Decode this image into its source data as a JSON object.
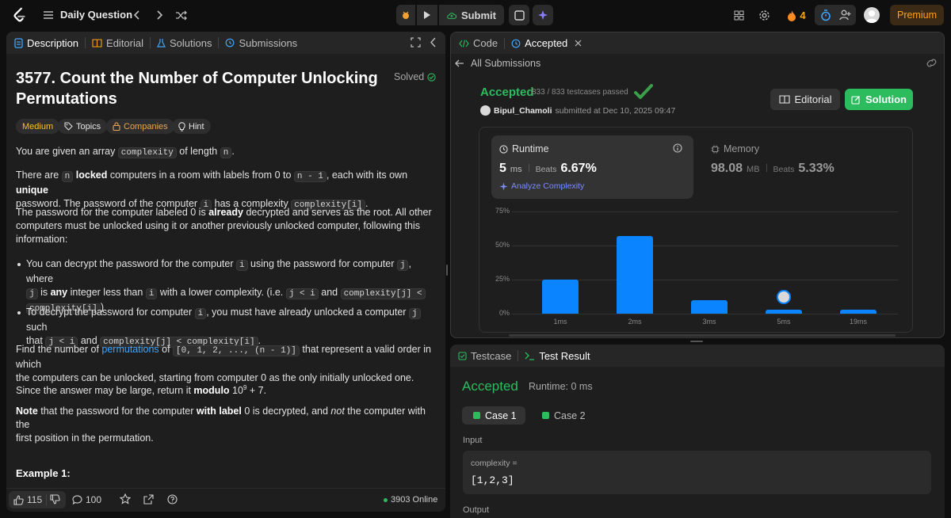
{
  "topbar": {
    "title": "Daily Question",
    "submit_label": "Submit",
    "streak_count": "4",
    "premium_label": "Premium"
  },
  "left_panel": {
    "tabs": [
      "Description",
      "Editorial",
      "Solutions",
      "Submissions"
    ],
    "problem_title_line1": "3577. Count the Number of Computer Unlocking",
    "problem_title_line2": "Permutations",
    "solved_label": "Solved",
    "tags": [
      "Medium",
      "Topics",
      "Companies",
      "Hint"
    ],
    "p1": {
      "a": "You are given an array ",
      "code1": "complexity",
      "b": " of length ",
      "code2": "n",
      "c": "."
    },
    "p2": {
      "a": "There are ",
      "code1": "n",
      "b1": " ",
      "bold1": "locked",
      "b2": " computers in a room with labels from 0 to ",
      "code2": "n - 1",
      "c1": ", each with its own ",
      "bold2": "unique",
      "d": "password. The password of the computer ",
      "code3": "i",
      "e": " has a complexity ",
      "code4": "complexity[i]",
      "f": "."
    },
    "p3": {
      "a": "The password for the computer labeled 0 is ",
      "bold": "already",
      "b": " decrypted and serves as the root. All other",
      "line2": "computers must be unlocked using it or another previously unlocked computer, following this",
      "line3": "information:"
    },
    "bullet1": {
      "a": "You can decrypt the password for the computer ",
      "code1": "i",
      "b": " using the password for computer ",
      "code2": "j",
      "c": ", where",
      "code3": "j",
      "d1": " is ",
      "bold": "any",
      "d2": " integer less than ",
      "code4": "i",
      "e": " with a lower complexity. (i.e. ",
      "code5": "j < i",
      "f": " and ",
      "code6": "complexity[j] <",
      "code7": "complexity[i]",
      "g": ")"
    },
    "bullet2": {
      "a": "To decrypt the password for computer ",
      "code1": "i",
      "b": ", you must have already unlocked a computer ",
      "code2": "j",
      "c": " such",
      "d": "that ",
      "code3": "j < i",
      "e": " and ",
      "code4": "complexity[j] < complexity[i]",
      "f": "."
    },
    "p4": {
      "a": "Find the number of ",
      "link": "permutations",
      "b": " of ",
      "code": "[0, 1, 2, ..., (n - 1)]",
      "c": " that represent a valid order in which",
      "line2": "the computers can be unlocked, starting from computer 0 as the only initially unlocked one."
    },
    "p5": {
      "a": "Since the answer may be large, return it ",
      "bold": "modulo",
      "b": " 10",
      "sup": "9",
      "c": " + 7."
    },
    "p6": {
      "bold1": "Note",
      "a": " that the password for the computer ",
      "bold2": "with label",
      "b": " 0 is decrypted, and ",
      "em": "not",
      "c": " the computer with the",
      "line2": "first position in the permutation."
    },
    "example_heading": "Example 1:",
    "footer": {
      "likes": "115",
      "comments": "100",
      "online": "3903 Online"
    }
  },
  "right_top": {
    "tabs": [
      "Code",
      "Accepted"
    ],
    "back_label": "All Submissions",
    "status": "Accepted",
    "testcases": "833 / 833 testcases passed",
    "user": "Bipul_Chamoli",
    "submitted": "submitted at Dec 10, 2025 09:47",
    "editorial_btn": "Editorial",
    "solution_btn": "Solution",
    "runtime": {
      "label": "Runtime",
      "value": "5",
      "unit": "ms",
      "beats_label": "Beats",
      "beats": "6.67%",
      "analyze": "Analyze Complexity"
    },
    "memory": {
      "label": "Memory",
      "value": "98.08",
      "unit": "MB",
      "beats_label": "Beats",
      "beats": "5.33%"
    }
  },
  "chart_data": {
    "type": "bar",
    "categories": [
      "1ms",
      "2ms",
      "3ms",
      "5ms",
      "19ms"
    ],
    "values": [
      25,
      57,
      10,
      3,
      3
    ],
    "yticks": [
      "75%",
      "50%",
      "25%",
      "0%"
    ],
    "ylim": [
      0,
      75
    ],
    "grid": true,
    "highlight": "5ms"
  },
  "right_bottom": {
    "tabs": [
      "Testcase",
      "Test Result"
    ],
    "status": "Accepted",
    "runtime": "Runtime: 0 ms",
    "cases": [
      "Case 1",
      "Case 2"
    ],
    "input_label": "Input",
    "var_name": "complexity =",
    "var_value": "[1,2,3]",
    "output_label": "Output"
  },
  "colors": {
    "accent_green": "#2cbb5d",
    "bar_blue": "#0a84ff",
    "medium": "#ffc01e",
    "premium": "#ffa116"
  }
}
